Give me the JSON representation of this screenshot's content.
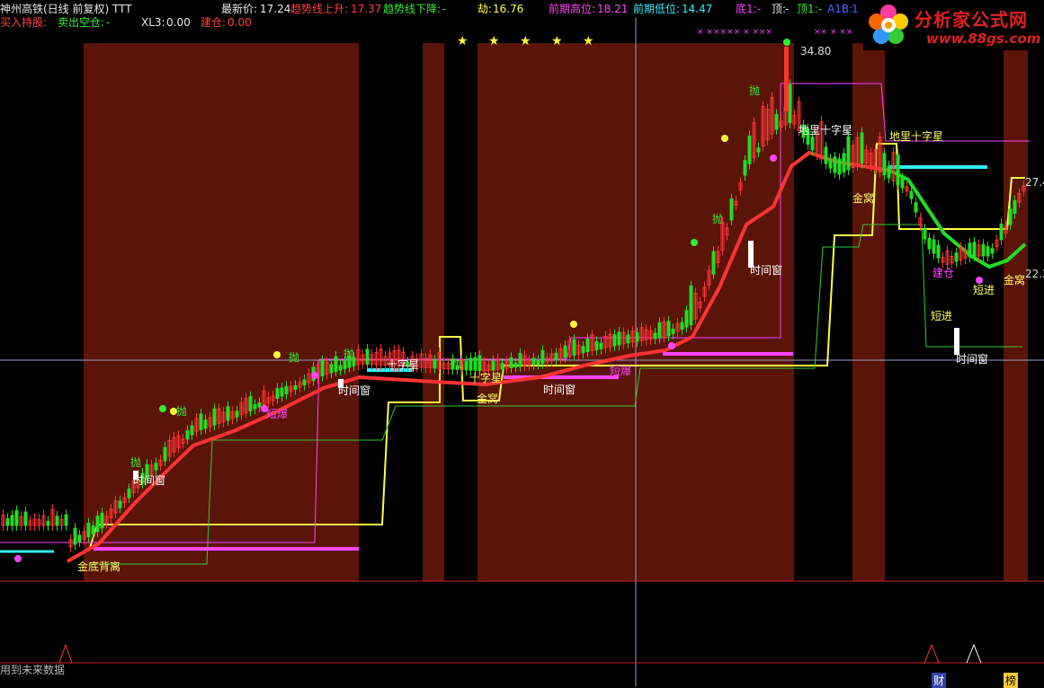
{
  "header": {
    "title": "神州高铁(日线 前复权) TTT",
    "latest_price_label": "最新价:",
    "latest_price": "17.24",
    "trend_up_label": "趋势线上升:",
    "trend_up_value": "17.37",
    "trend_down_label": "趋势线下降:",
    "trend_down_value": "-",
    "jie_label": "劫:",
    "jie_value": "16.76",
    "prev_high_label": "前期高位:",
    "prev_high_value": "18.21",
    "prev_low_label": "前期低位:",
    "prev_low_value": "14.47",
    "bottom_label": "底1:",
    "bottom_value": "-",
    "top_label": "顶:",
    "top_value": "-",
    "top1_label": "顶1:",
    "top1_value": "-",
    "a1b_label": "A1B:",
    "a1b_value": "1"
  },
  "row2": {
    "buy_hold": "买入持股:",
    "sell_empty_label": "卖出空仓:",
    "sell_empty_value": "-",
    "xl3_label": "XL3:",
    "xl3_value": "0.00",
    "build_label": "建仓:",
    "build_value": "0.00"
  },
  "logo": {
    "title": "分析家公式网",
    "url": "www.88gs.com"
  },
  "price_labels": {
    "high": "34.80",
    "right_upper": "27.4",
    "right_lower": "22.2"
  },
  "annotations": {
    "gold_bottom_divergence": "金底背离",
    "time_window": "时间窗",
    "throw": "抛",
    "diliu_cross": "地里十字星",
    "gold_nest": "金窝",
    "short_enter": "短进",
    "build": "建仓",
    "cross_star": "十字星",
    "surge": "短爆"
  },
  "footer": {
    "future_data_note": "用到未来数据",
    "tag_cai": "财",
    "tag_bang": "榜"
  },
  "colors": {
    "bg": "#000000",
    "zone": "#5a1408",
    "up": "#ff3333",
    "down": "#22dd22",
    "yellow": "#ffff44",
    "magenta": "#ff44ff",
    "cyan": "#33eeff"
  }
}
